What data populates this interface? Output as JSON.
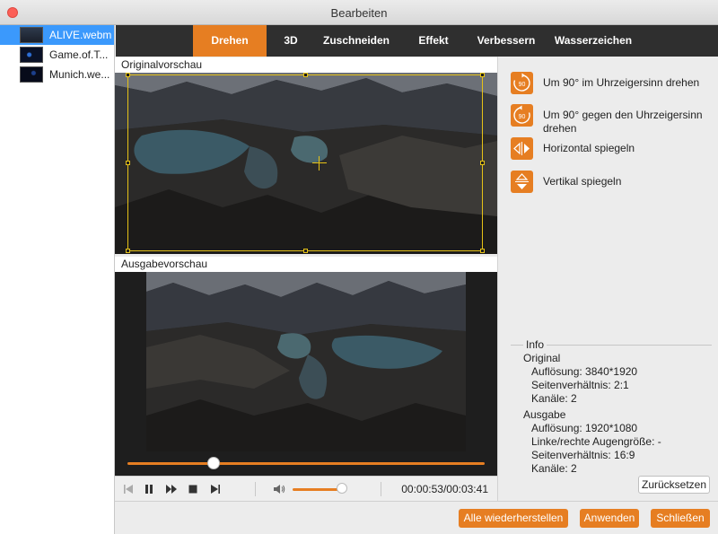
{
  "window": {
    "title": "Bearbeiten"
  },
  "files": [
    {
      "name": "ALIVE.webm",
      "selected": true
    },
    {
      "name": "Game.of.T...",
      "selected": false
    },
    {
      "name": "Munich.we...",
      "selected": false
    }
  ],
  "tabs": [
    {
      "label": "Drehen",
      "active": true
    },
    {
      "label": "3D",
      "active": false
    },
    {
      "label": "Zuschneiden",
      "active": false
    },
    {
      "label": "Effekt",
      "active": false
    },
    {
      "label": "Verbessern",
      "active": false
    },
    {
      "label": "Wasserzeichen",
      "active": false
    }
  ],
  "preview": {
    "original_label": "Originalvorschau",
    "output_label": "Ausgabevorschau"
  },
  "player": {
    "progress": 0.24,
    "volume": 0.85,
    "time": "00:00:53/00:03:41"
  },
  "actions": [
    {
      "label": "Um 90° im Uhrzeigersinn drehen",
      "icon": "rotate-clockwise-icon",
      "icon_text": "90"
    },
    {
      "label": "Um 90° gegen den Uhrzeigersinn drehen",
      "icon": "rotate-counterclockwise-icon",
      "icon_text": "90"
    },
    {
      "label": "Horizontal spiegeln",
      "icon": "flip-horizontal-icon"
    },
    {
      "label": "Vertikal spiegeln",
      "icon": "flip-vertical-icon"
    }
  ],
  "info": {
    "title": "Info",
    "original": {
      "heading": "Original",
      "resolution": "Auflösung: 3840*1920",
      "aspect": "Seitenverhältnis: 2:1",
      "channels": "Kanäle: 2"
    },
    "output": {
      "heading": "Ausgabe",
      "resolution": "Auflösung: 1920*1080",
      "eye_size": "Linke/rechte Augengröße: -",
      "aspect": "Seitenverhältnis: 16:9",
      "channels": "Kanäle: 2"
    }
  },
  "buttons": {
    "reset": "Zurücksetzen",
    "restore_all": "Alle wiederherstellen",
    "apply": "Anwenden",
    "close": "Schließen"
  },
  "colors": {
    "accent": "#e67e22",
    "crop_frame": "#e6c217",
    "selection": "#3b99fc"
  }
}
